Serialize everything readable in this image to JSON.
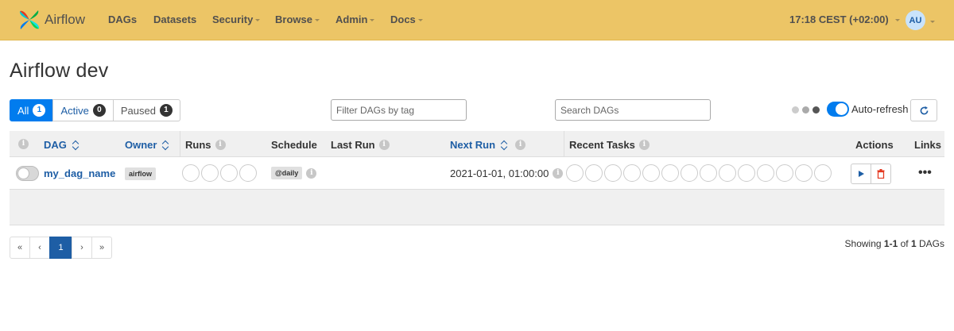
{
  "navbar": {
    "brand": "Airflow",
    "items": [
      {
        "label": "DAGs",
        "dropdown": false
      },
      {
        "label": "Datasets",
        "dropdown": false
      },
      {
        "label": "Security",
        "dropdown": true
      },
      {
        "label": "Browse",
        "dropdown": true
      },
      {
        "label": "Admin",
        "dropdown": true
      },
      {
        "label": "Docs",
        "dropdown": true
      }
    ],
    "time": "17:18 CEST (+02:00)",
    "avatar": "AU",
    "colors": {
      "background": "#ecc566",
      "text": "#51504f"
    }
  },
  "page_title": "Airflow dev",
  "status_filter": {
    "all": {
      "label": "All",
      "count": "1"
    },
    "active": {
      "label": "Active",
      "count": "0"
    },
    "paused": {
      "label": "Paused",
      "count": "1"
    }
  },
  "filters": {
    "tag_placeholder": "Filter DAGs by tag",
    "search_placeholder": "Search DAGs"
  },
  "auto_refresh": {
    "label": "Auto-refresh",
    "enabled": true
  },
  "table": {
    "headers": {
      "dag": "DAG",
      "owner": "Owner",
      "runs": "Runs",
      "schedule": "Schedule",
      "last_run": "Last Run",
      "next_run": "Next Run",
      "recent_tasks": "Recent Tasks",
      "actions": "Actions",
      "links": "Links"
    },
    "rows": [
      {
        "dag_id": "my_dag_name",
        "paused": true,
        "owner": "airflow",
        "run_circles": 4,
        "schedule": "@daily",
        "last_run": "",
        "next_run": "2021-01-01, 01:00:00",
        "task_circles": 14,
        "links": "•••"
      }
    ]
  },
  "pagination": {
    "first": "«",
    "prev": "‹",
    "current": "1",
    "next": "›",
    "last": "»"
  },
  "summary": {
    "prefix": "Showing",
    "range": "1-1",
    "of": "of",
    "total": "1",
    "suffix": "DAGs"
  },
  "accent_color": "#017cee",
  "link_color": "#1e5ea5"
}
